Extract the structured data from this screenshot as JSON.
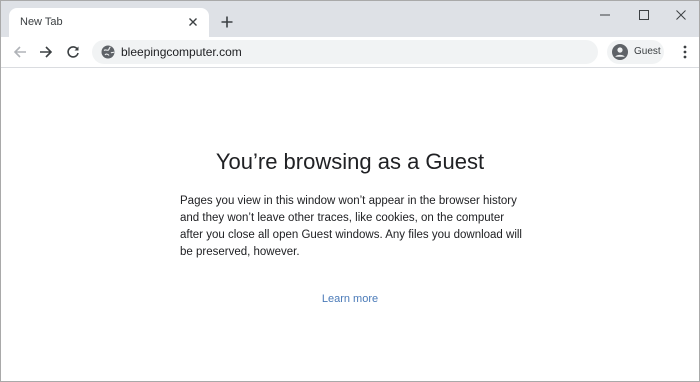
{
  "tab": {
    "title": "New Tab"
  },
  "toolbar": {
    "url": "bleepingcomputer.com"
  },
  "profile": {
    "label": "Guest"
  },
  "content": {
    "title": "You’re browsing as a Guest",
    "description": "Pages you view in this window won’t appear in the browser history and they won’t leave other traces, like cookies, on the computer after you close all open Guest windows. Any files you download will be preserved, however.",
    "learn_more": "Learn more"
  },
  "colors": {
    "tabstrip": "#dee1e6",
    "link": "#4a7ab8",
    "omnibox": "#f1f3f4"
  },
  "icons": [
    "close-icon",
    "plus-icon",
    "minimize-icon",
    "maximize-icon",
    "window-close-icon",
    "back-arrow-icon",
    "forward-arrow-icon",
    "reload-icon",
    "globe-icon",
    "guest-avatar-icon",
    "more-vert-icon"
  ]
}
